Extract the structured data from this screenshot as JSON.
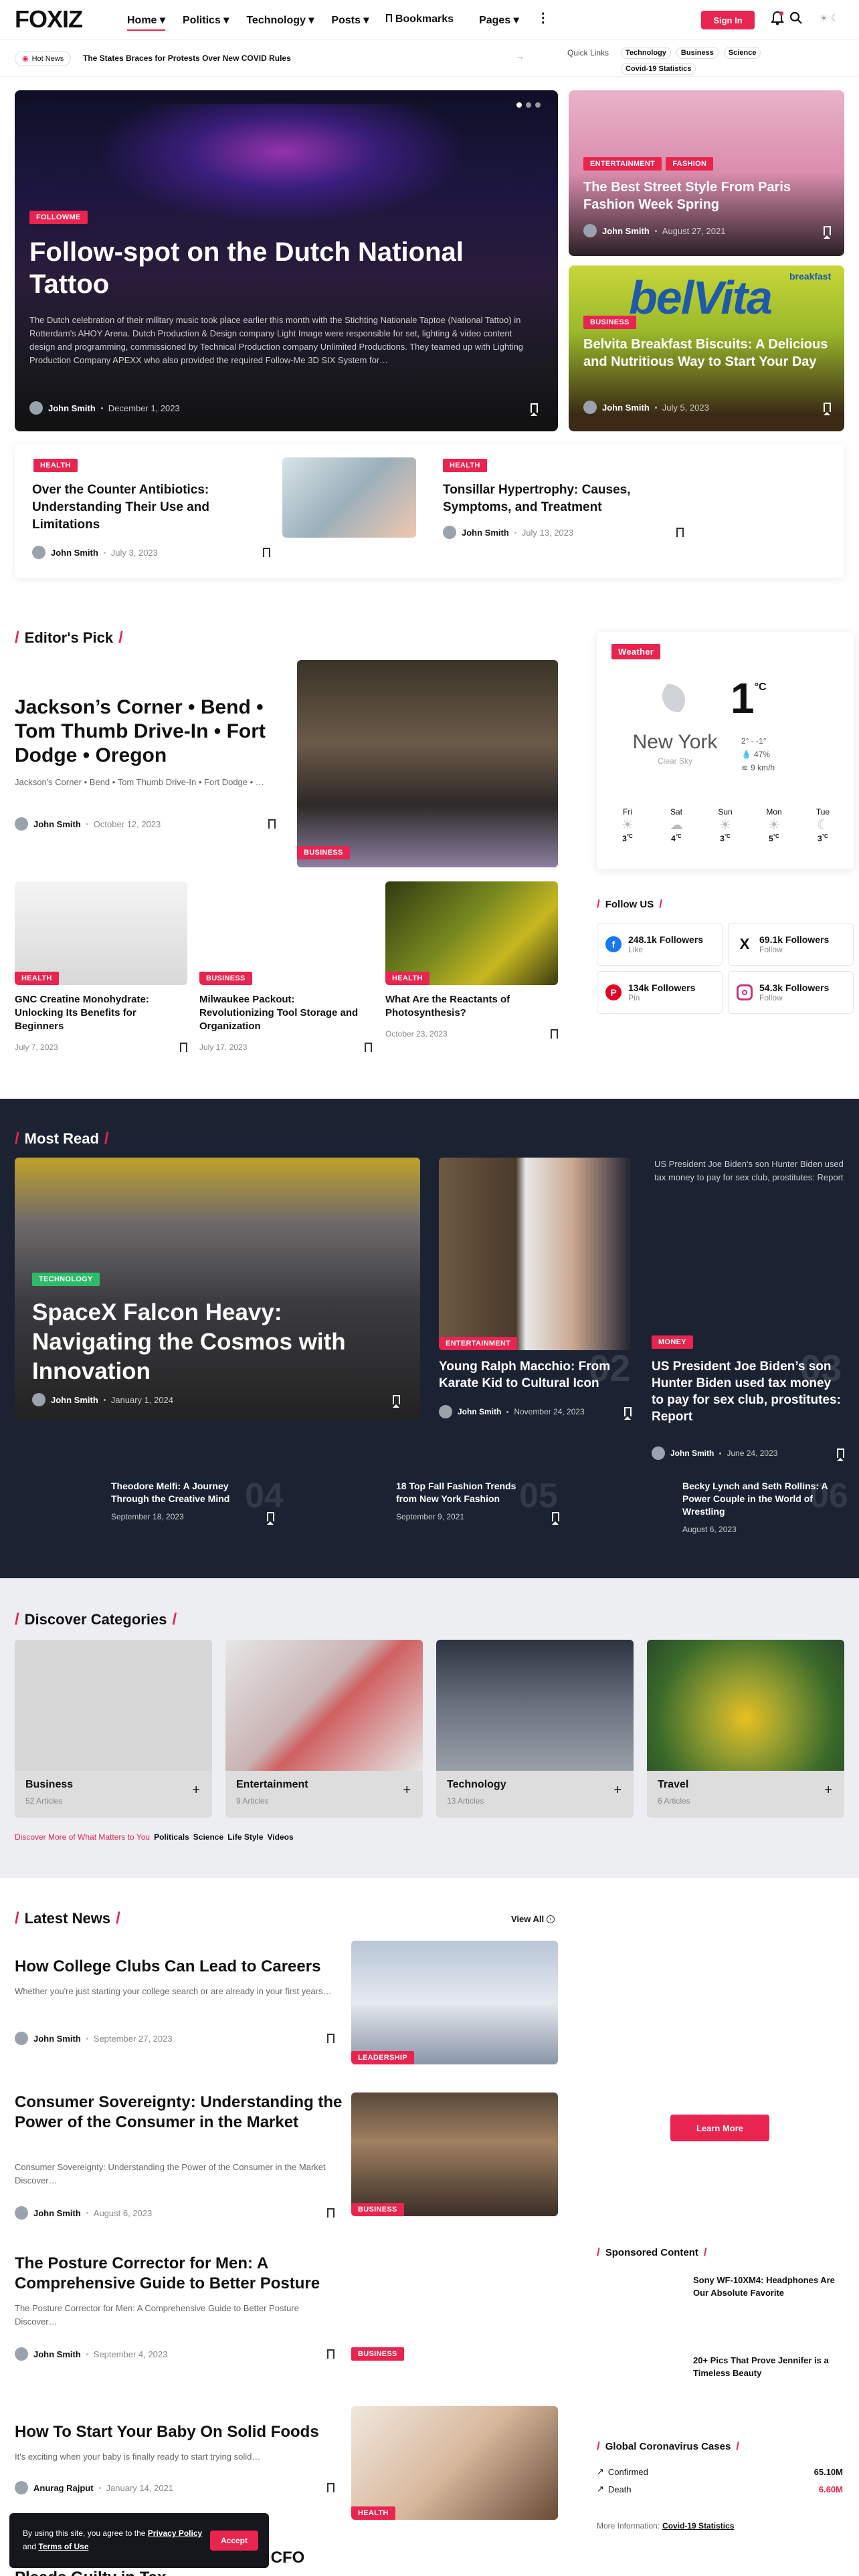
{
  "header": {
    "logo": "FOXIZ",
    "nav": [
      "Home",
      "Politics",
      "Technology",
      "Posts",
      "Bookmarks",
      "Pages"
    ],
    "signin": "Sign In"
  },
  "ticker": {
    "label": "Hot News",
    "headline": "The States Braces for Protests Over New COVID Rules",
    "quick_label": "Quick Links",
    "quick": [
      "Technology",
      "Business",
      "Science",
      "Covid-19 Statistics"
    ]
  },
  "hero": {
    "badge": "FOLLOWME",
    "title": "Follow-spot on the Dutch National Tattoo",
    "excerpt": "The Dutch celebration of their military music took place earlier this month with the Stichting Nationale Taptoe (National Tattoo) in Rotterdam's AHOY Arena. Dutch Production & Design company Light Image were responsible for set, lighting & video content design and programming, commissioned by Technical Production company Unlimited Productions. They teamed up with Lighting Production Company APEXX who also provided the required Follow-Me 3D SIX System for…",
    "author": "John Smith",
    "date": "December 1, 2023"
  },
  "side1": {
    "badges": [
      "ENTERTAINMENT",
      "FASHION"
    ],
    "title": "The Best Street Style From Paris Fashion Week Spring",
    "author": "John Smith",
    "date": "August 27, 2021"
  },
  "side2": {
    "badge": "BUSINESS",
    "title": "Belvita Breakfast Biscuits: A Delicious and Nutritious Way to Start Your Day",
    "author": "John Smith",
    "date": "July 5, 2023",
    "brand": "belVita",
    "brand_tag": "breakfast"
  },
  "row1": [
    {
      "badge": "HEALTH",
      "title": "Over the Counter Antibiotics: Understanding Their Use and Limitations",
      "author": "John Smith",
      "date": "July 3, 2023"
    },
    {
      "badge": "HEALTH",
      "title": "Tonsillar Hypertrophy: Causes, Symptoms, and Treatment",
      "author": "John Smith",
      "date": "July 13, 2023"
    }
  ],
  "editors": {
    "title": "Editor's Pick",
    "main": {
      "title": "Jackson’s Corner • Bend • Tom Thumb Drive-In • Fort Dodge • Oregon",
      "excerpt": "Jackson's Corner • Bend • Tom Thumb Drive-In • Fort Dodge • …",
      "author": "John Smith",
      "date": "October 12, 2023",
      "badge": "BUSINESS"
    },
    "cards": [
      {
        "badge": "HEALTH",
        "title": "GNC Creatine Monohydrate: Unlocking Its Benefits for Beginners",
        "date": "July 7, 2023"
      },
      {
        "badge": "BUSINESS",
        "title": "Milwaukee Packout: Revolutionizing Tool Storage and Organization",
        "date": "July 17, 2023"
      },
      {
        "badge": "HEALTH",
        "title": "What Are the Reactants of Photosynthesis?",
        "date": "October 23, 2023"
      }
    ]
  },
  "weather": {
    "badge": "Weather",
    "temp": "1",
    "unit": "°C",
    "city": "New York",
    "cond": "Clear Sky",
    "range": "2° - -1°",
    "humidity": "47%",
    "wind": "9 km/h",
    "days": [
      {
        "d": "Fri",
        "t": "3"
      },
      {
        "d": "Sat",
        "t": "4"
      },
      {
        "d": "Sun",
        "t": "3"
      },
      {
        "d": "Mon",
        "t": "5"
      },
      {
        "d": "Tue",
        "t": "3"
      }
    ]
  },
  "follow": {
    "title": "Follow US",
    "items": [
      {
        "count": "248.1k Followers",
        "label": "Like",
        "color": "#1877f2"
      },
      {
        "count": "69.1k Followers",
        "label": "Follow",
        "color": "#111111"
      },
      {
        "count": "134k Followers",
        "label": "Pin",
        "color": "#e60023"
      },
      {
        "count": "54.3k Followers",
        "label": "Follow",
        "color": "#c13584"
      }
    ]
  },
  "mostread": {
    "title": "Most Read",
    "main": {
      "badge": "TECHNOLOGY",
      "title": "SpaceX Falcon Heavy: Navigating the Cosmos with Innovation",
      "author": "John Smith",
      "date": "January 1, 2024"
    },
    "mid": {
      "badge": "ENTERTAINMENT",
      "title": "Young Ralph Macchio: From Karate Kid to Cultural Icon",
      "author": "John Smith",
      "date": "November 24, 2023",
      "num": "02"
    },
    "right": {
      "alt": "US President Joe Biden's son Hunter Biden used tax money to pay for sex club, prostitutes: Report",
      "badge": "MONEY",
      "title": "US President Joe Biden’s son Hunter Biden used tax money to pay for sex club, prostitutes: Report",
      "author": "John Smith",
      "date": "June 24, 2023",
      "num": "03"
    },
    "small": [
      {
        "title": "Theodore Melfi: A Journey Through the Creative Mind",
        "date": "September 18, 2023",
        "num": "04"
      },
      {
        "title": "18 Top Fall Fashion Trends from New York Fashion",
        "date": "September 9, 2021",
        "num": "05"
      },
      {
        "title": "Becky Lynch and Seth Rollins: A Power Couple in the World of Wrestling",
        "date": "August 6, 2023",
        "num": "06"
      }
    ]
  },
  "categories": {
    "title": "Discover Categories",
    "items": [
      {
        "name": "Business",
        "count": "52 Articles"
      },
      {
        "name": "Entertainment",
        "count": "9 Articles"
      },
      {
        "name": "Technology",
        "count": "13 Articles"
      },
      {
        "name": "Travel",
        "count": "6 Articles"
      }
    ],
    "more_label": "Discover More of What Matters to You",
    "more_links": [
      "Politicals",
      "Science",
      "Life Style",
      "Videos"
    ]
  },
  "latest": {
    "title": "Latest News",
    "view_all": "View All",
    "items": [
      {
        "title": "How College Clubs Can Lead to Careers",
        "excerpt": "Whether you're just starting your college search or are already in your first years…",
        "author": "John Smith",
        "date": "September 27, 2023",
        "badge": "LEADERSHIP"
      },
      {
        "title": "Consumer Sovereignty: Understanding the Power of the Consumer in the Market",
        "excerpt": "Consumer Sovereignty: Understanding the Power of the Consumer in the Market Discover…",
        "author": "John Smith",
        "date": "August 6, 2023",
        "badge": "BUSINESS"
      },
      {
        "title": "The Posture Corrector for Men: A Comprehensive Guide to Better Posture",
        "excerpt": "The Posture Corrector for Men: A Comprehensive Guide to Better Posture Discover…",
        "author": "John Smith",
        "date": "September 4, 2023",
        "badge": "BUSINESS"
      },
      {
        "title": "How To Start Your Baby On Solid Foods",
        "excerpt": "It's exciting when your baby is finally ready to start trying solid…",
        "author": "Anurag Rajput",
        "date": "January 14, 2021",
        "badge": "HEALTH"
      }
    ],
    "partial_title": "…ing Knight Trump Organization CFO Pleads Guilty in Tax"
  },
  "learn_more": "Learn More",
  "sponsored": {
    "title": "Sponsored Content",
    "items": [
      "Sony WF-10XM4: Headphones Are Our Absolute Favorite",
      "20+ Pics That Prove Jennifer is a Timeless Beauty"
    ]
  },
  "covid": {
    "title": "Global Coronavirus Cases",
    "confirmed_label": "Confirmed",
    "confirmed": "65.10M",
    "death_label": "Death",
    "death": "6.60M",
    "more_label": "More Information:",
    "more_link": "Covid-19 Statistics"
  },
  "cookie": {
    "text_1": "By using this site, you agree to the",
    "privacy": "Privacy Policy",
    "and": "and",
    "terms": "Terms of Use",
    "accept": "Accept"
  },
  "colors": {
    "accent": "#e8244f",
    "dark": "#1b2333"
  }
}
